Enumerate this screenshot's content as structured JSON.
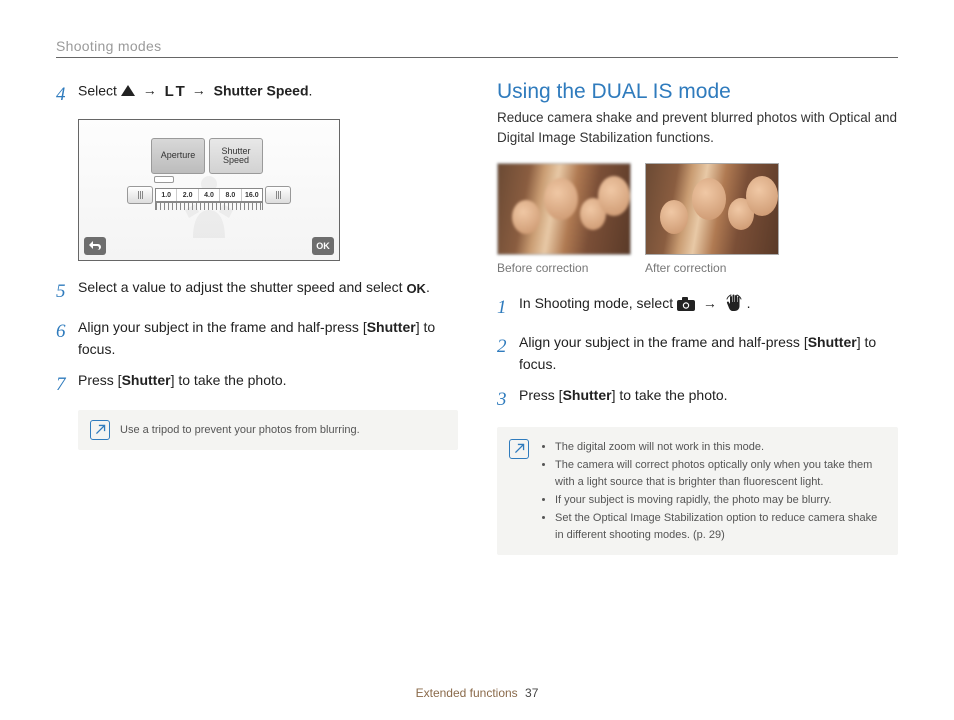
{
  "header": {
    "breadcrumb": "Shooting modes"
  },
  "left": {
    "step4": {
      "num": "4",
      "pre": "Select ",
      "lt": "L T",
      "arrow": "→",
      "bold": "Shutter Speed",
      "post": "."
    },
    "screen": {
      "tab_aperture": "Aperture",
      "tab_shutter": "Shutter\nSpeed",
      "scale": [
        "1.0",
        "2.0",
        "4.0",
        "8.0",
        "16.0"
      ],
      "back": "↩",
      "ok": "OK"
    },
    "step5": {
      "num": "5",
      "pre": "Select a value to adjust the shutter speed and select ",
      "ok": "OK",
      "post": "."
    },
    "step6": {
      "num": "6",
      "pre": "Align your subject in the frame and half-press [",
      "bold": "Shutter",
      "post": "] to focus."
    },
    "step7": {
      "num": "7",
      "pre": "Press [",
      "bold": "Shutter",
      "post": "] to take the photo."
    },
    "note": "Use a tripod to prevent your photos from blurring."
  },
  "right": {
    "title": "Using the DUAL IS mode",
    "sub": "Reduce camera shake and prevent blurred photos with Optical and Digital Image Stabilization functions.",
    "cap_before": "Before correction",
    "cap_after": "After correction",
    "step1": {
      "num": "1",
      "pre": "In Shooting mode, select ",
      "arrow": "→",
      "post": " ."
    },
    "step2": {
      "num": "2",
      "pre": "Align your subject in the frame and half-press [",
      "bold": "Shutter",
      "post": "] to focus."
    },
    "step3": {
      "num": "3",
      "pre": "Press [",
      "bold": "Shutter",
      "post": "] to take the photo."
    },
    "notes": [
      "The digital zoom will not work in this mode.",
      "The camera will correct photos optically only when you take them with a light source that is brighter than fluorescent light.",
      "If your subject is moving rapidly, the photo may be blurry.",
      "Set the Optical Image Stabilization option to reduce camera shake in different shooting modes. (p. 29)"
    ]
  },
  "footer": {
    "section": "Extended functions",
    "page": "37"
  }
}
